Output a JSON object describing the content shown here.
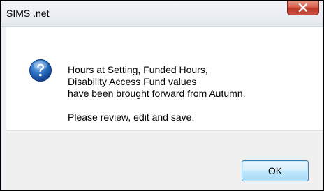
{
  "window": {
    "title": "SIMS .net"
  },
  "icons": {
    "close": "close-icon",
    "question": "question-icon"
  },
  "message": {
    "line1": "Hours at Setting, Funded Hours,",
    "line2": "Disability Access Fund values",
    "line3": "have been brought forward from Autumn.",
    "line4": "Please review, edit and save."
  },
  "buttons": {
    "ok_label": "OK"
  },
  "colors": {
    "close_red": "#c0392b",
    "icon_blue": "#1e63b5",
    "ok_border": "#3c7fb1",
    "footer_bg": "#f0f0f0"
  }
}
